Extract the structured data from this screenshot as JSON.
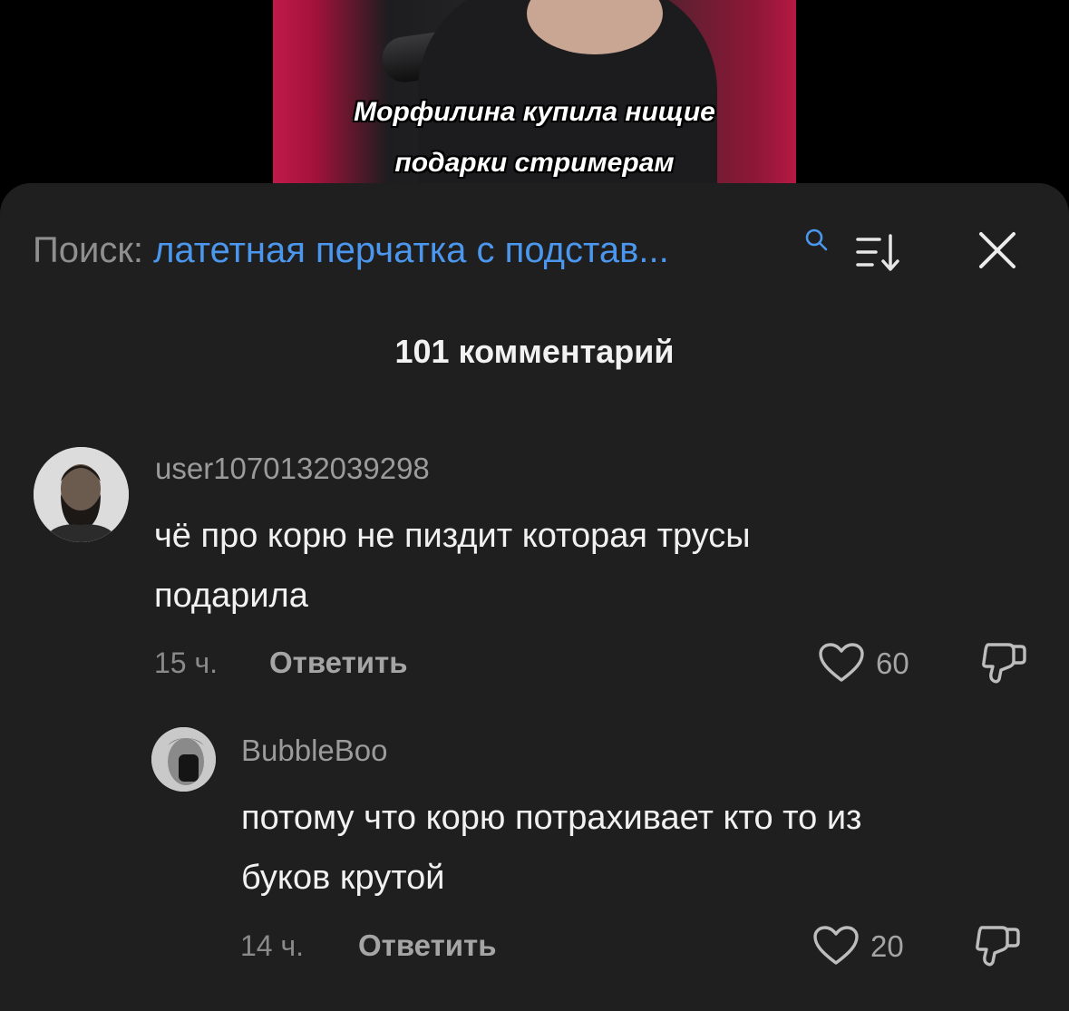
{
  "video": {
    "caption_line1": "Морфилина купила нищие",
    "caption_line2": "подарки стримерам"
  },
  "header": {
    "search_label": "Поиск:",
    "search_query": "латетная перчатка с подстав..."
  },
  "comments_count": "101 комментарий",
  "comments": [
    {
      "username": "user1070132039298",
      "text_line1": "чё про корю не пиздит которая трусы",
      "text_line2": "подарила",
      "time": "15 ч.",
      "reply_label": "Ответить",
      "likes": "60"
    },
    {
      "username": "BubbleBoo",
      "text_line1": "потому что корю потрахивает кто то из",
      "text_line2": "буков крутой",
      "time": "14 ч.",
      "reply_label": "Ответить",
      "likes": "20"
    }
  ],
  "colors": {
    "accent": "#4c97ee",
    "sheet_bg": "#1f1f1f",
    "page_bg": "#000000"
  },
  "icons": [
    "search-icon",
    "sort-icon",
    "close-icon",
    "heart-icon",
    "dislike-icon"
  ]
}
